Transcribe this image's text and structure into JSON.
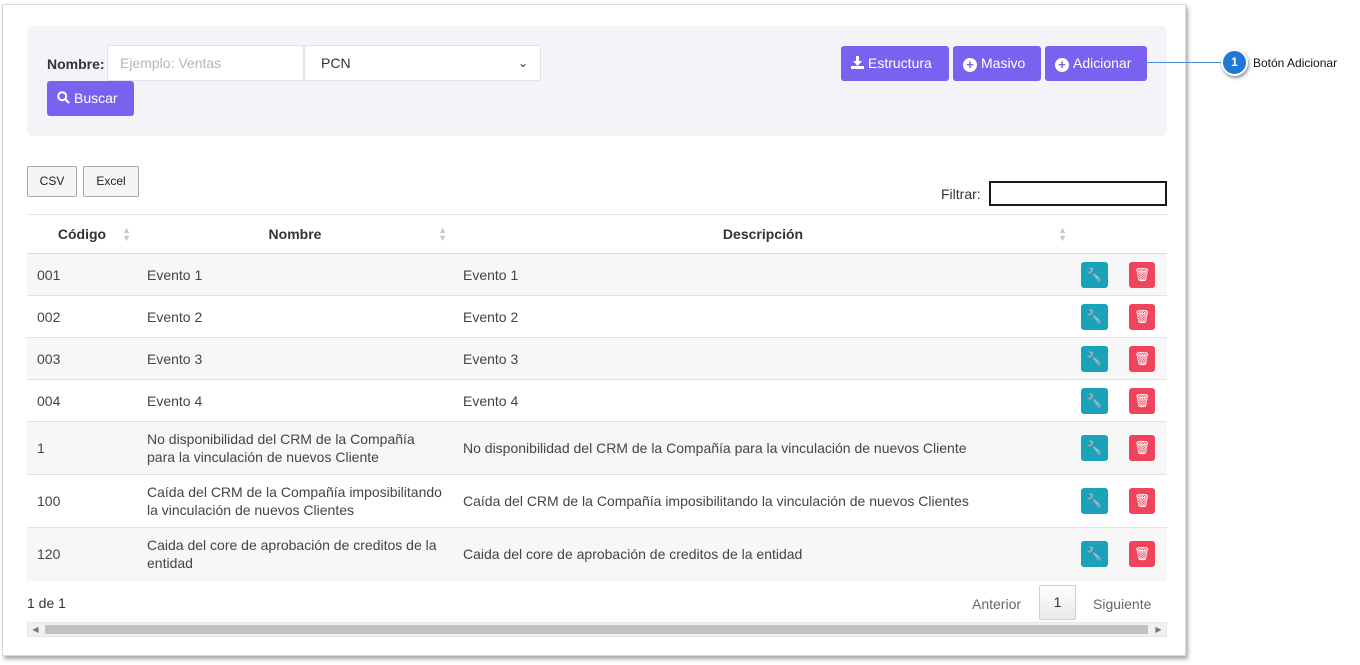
{
  "search": {
    "label": "Nombre:",
    "placeholder": "Ejemplo: Ventas",
    "select_value": "PCN",
    "buscar_label": "Buscar"
  },
  "toolbar": {
    "estructura_label": "Estructura",
    "masivo_label": "Masivo",
    "adicionar_label": "Adicionar"
  },
  "export": {
    "csv_label": "CSV",
    "excel_label": "Excel"
  },
  "filter": {
    "label": "Filtrar:"
  },
  "table": {
    "headers": {
      "codigo": "Código",
      "nombre": "Nombre",
      "descripcion": "Descripción"
    },
    "rows": [
      {
        "codigo": "001",
        "nombre": "Evento 1",
        "descripcion": "Evento 1"
      },
      {
        "codigo": "002",
        "nombre": "Evento 2",
        "descripcion": "Evento 2"
      },
      {
        "codigo": "003",
        "nombre": "Evento 3",
        "descripcion": "Evento 3"
      },
      {
        "codigo": "004",
        "nombre": "Evento 4",
        "descripcion": "Evento 4"
      },
      {
        "codigo": "1",
        "nombre": "No disponibilidad del CRM de la Compañía para la vinculación de nuevos Cliente",
        "descripcion": "No disponibilidad del CRM de la Compañía para la vinculación de nuevos Cliente"
      },
      {
        "codigo": "100",
        "nombre": "Caída del CRM de la Compañía imposibilitando la vinculación de nuevos Clientes",
        "descripcion": "Caída del CRM de la Compañía imposibilitando la vinculación de nuevos Clientes"
      },
      {
        "codigo": "120",
        "nombre": "Caida del core de aprobación de creditos de la entidad",
        "descripcion": "Caida del core de aprobación de creditos de la entidad"
      }
    ]
  },
  "pagination": {
    "info": "1 de 1",
    "prev": "Anterior",
    "current": "1",
    "next": "Siguiente"
  },
  "callout": {
    "number": "1",
    "text": "Botón Adicionar"
  },
  "colors": {
    "primary": "#7b61ef",
    "edit": "#1aa3b8",
    "delete": "#f0435c",
    "callout": "#1f77d6"
  },
  "icons": {
    "estructura": "download-icon",
    "masivo": "plus-circle-icon",
    "adicionar": "plus-circle-icon",
    "buscar": "search-icon",
    "edit": "wrench-icon",
    "delete": "trash-icon"
  }
}
